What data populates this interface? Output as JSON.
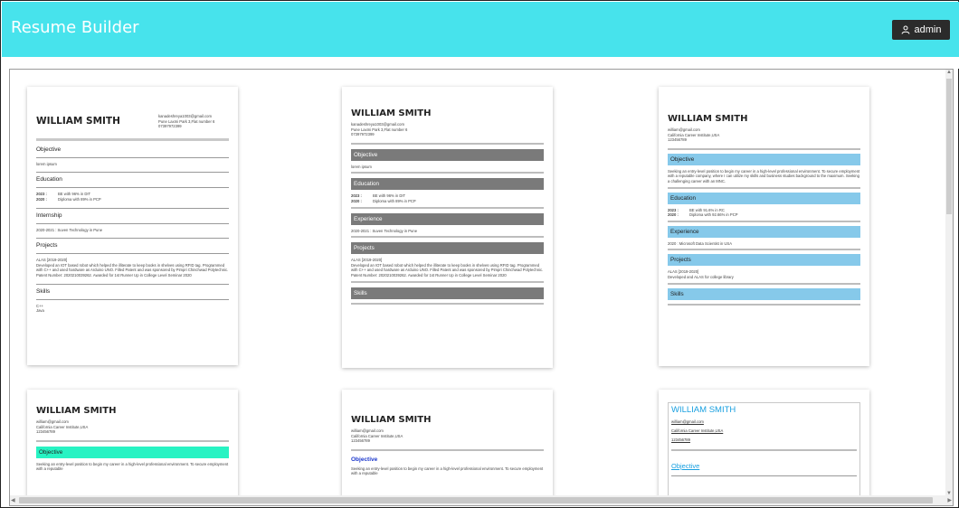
{
  "header": {
    "title": "Resume Builder",
    "user_label": "admin"
  },
  "resumes": {
    "c1": {
      "name": "WILLIAM SMITH",
      "email": "kanadeshreya1003@gmail.com",
      "address": "Pune Laxmi Park 3,Flat number 6",
      "phone": "07397972399",
      "objective_head": "Objective",
      "objective_text": "lorem ipsum",
      "education_head": "Education",
      "edu": [
        {
          "year": "2023 :",
          "text": "BE with 96% in DIT"
        },
        {
          "year": "2020 :",
          "text": "Diploma with 89% in PCP"
        }
      ],
      "internship_head": "Internship",
      "internship_text": "2020-2021 : Suven Technology in Pune",
      "projects_head": "Projects",
      "project_title": "ALAS [2019-2020]",
      "project_text": "Developed an IOT based robot which helped the illiterate to keep books in shelves using RFID tag. Programmed with C++ and used hardware as Arduino UNO. Filled Patent and was sponsored by Pimpri Chinchwad Polytechnic. Patent Number: 2020210039262. Awarded for 1st Runner Up in College Level Seminar 2020",
      "skills_head": "Skills",
      "skill1": "C++",
      "skill2": "Java"
    },
    "c2": {
      "name": "WILLIAM SMITH",
      "email": "kanadeshreya1003@gmail.com",
      "address": "Pune Laxmi Park 3,Flat number 6",
      "phone": "07397972399",
      "objective_head": "Objective",
      "objective_text": "lorem ipsum",
      "education_head": "Education",
      "edu": [
        {
          "year": "2023 :",
          "text": "BE with 96% in DIT"
        },
        {
          "year": "2020 :",
          "text": "Diploma with 89% in PCP"
        }
      ],
      "experience_head": "Experience",
      "experience_text": "2020-2021 : Suven Technology in Pune",
      "projects_head": "Projects",
      "project_title": "ALAS [2019-2020]",
      "project_text": "Developed an IOT based robot which helped the illiterate to keep books in shelves using RFID tag. Programmed with C++ and used hardware as Arduino UNO. Filled Patent and was sponsored by Pimpri Chinchwad Polytechnic. Patent Number: 2020210039262. Awarded for 1st Runner Up in College Level Seminar 2020",
      "skills_head": "Skills"
    },
    "c3": {
      "name": "WILLIAM SMITH",
      "email": "william@gmail.com",
      "address": "California Career Institute,USA",
      "phone": "123456789",
      "objective_head": "Objective",
      "objective_text": "Seeking an entry-level position to begin my career in a high-level professional environment. To secure employment with a reputable company, where I can utilize my skills and business studies background to the maximum. Seeking a challenging career with an MNC.",
      "education_head": "Education",
      "edu": [
        {
          "year": "2023 :",
          "text": "BE with 91.6% in RC"
        },
        {
          "year": "2020 :",
          "text": "Diploma with 92.66% in PCP"
        }
      ],
      "experience_head": "Experience",
      "experience_text": "2020 :      Microsoft Data Scientist in USA",
      "projects_head": "Projects",
      "project_title": "ALAS [2019-2020]",
      "project_text": "Developed and ALAS for college library",
      "skills_head": "Skills"
    },
    "c4": {
      "name": "WILLIAM SMITH",
      "email": "william@gmail.com",
      "address": "California Career Institute,USA",
      "phone": "123456789",
      "objective_head": "Objective",
      "objective_text": "Seeking an entry-level position to begin my career in a high-level professional environment. To secure employment with a reputable"
    },
    "c5": {
      "name": "WILLIAM SMITH",
      "email": "william@gmail.com",
      "address": "California Career Institute,USA",
      "phone": "123456789",
      "objective_head": "Objective",
      "objective_text": "Seeking an entry-level position to begin my career in a high-level professional environment. To secure employment with a reputable"
    },
    "c6": {
      "name": "WILLIAM SMITH",
      "email": "william@gmail.com",
      "address": "California Career Institute,USA",
      "phone": "123456789",
      "objective_head": "Objective"
    }
  },
  "colors": {
    "header": "#47e3ec",
    "gray_bar": "#7a7a7a",
    "blue_bar": "#86c9ea",
    "teal_bar": "#27f3c3",
    "link": "#1aa0e0"
  },
  "icons": {
    "user": "user-icon"
  }
}
